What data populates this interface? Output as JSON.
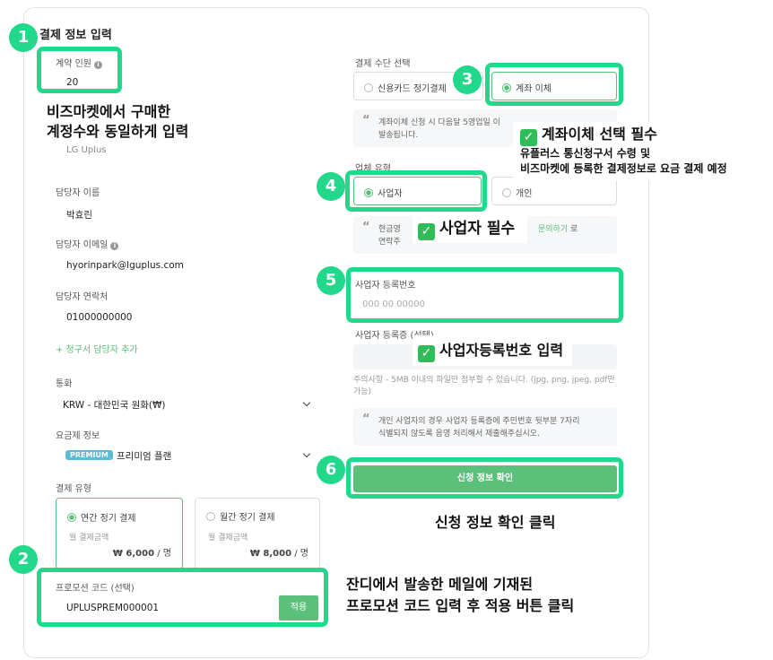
{
  "form": {
    "title": "결제 정보 입력",
    "contract_people": {
      "label": "계약 인원",
      "value": "20"
    },
    "company": {
      "value": "LG Uplus"
    },
    "manager_name": {
      "label": "담당자 이름",
      "value": "박효린"
    },
    "manager_email": {
      "label": "담당자 이메일",
      "value": "hyorinpark@lguplus.com"
    },
    "manager_phone": {
      "label": "담당자 연락처",
      "value": "01000000000"
    },
    "add_billing_contact": "+ 청구서 담당자 추가",
    "currency": {
      "label": "통화",
      "value": "KRW - 대한민국 원화(₩)"
    },
    "plan": {
      "label": "요금제 정보",
      "badge": "PREMIUM",
      "value": "프리미엄 플랜"
    },
    "billing_type": {
      "label": "결제 유형",
      "annual": {
        "label": "연간 정기 결제",
        "sub": "월 결제금액",
        "price": "₩ 6,000",
        "unit": " / 명"
      },
      "monthly": {
        "label": "월간 정기 결제",
        "sub": "월 결제금액",
        "price": "₩ 8,000",
        "unit": " / 명"
      }
    },
    "promo": {
      "label": "프로모션 코드 (선택)",
      "value": "UPLUSPREM000001",
      "apply": "적용"
    },
    "payment_method": {
      "label": "결제 수단 선택",
      "card": "신용카드 정기결제",
      "transfer": "계좌 이체"
    },
    "transfer_note": [
      "계좌이체 신청 시 다음달 5영업일 이",
      "발송됩니다."
    ],
    "business_type": {
      "label": "업체 유형",
      "business": "사업자",
      "individual": "개인"
    },
    "cash_note": {
      "line1_a": "현금영",
      "line1_link": "문의하기",
      "line1_b": " 로",
      "line2": "연락주"
    },
    "biz_number": {
      "label": "사업자 등록번호",
      "placeholder": "000 00 00000"
    },
    "biz_cert": {
      "label": "사업자 등록증 (선택)"
    },
    "upload_note": [
      "주의사항 - 5MB 이내의 파일만 첨부할 수 있습니다. (jpg, png, jpeg, pdf만",
      "가능)"
    ],
    "individual_note": [
      "개인 사업자의 경우 사업자 등록증에 주민번호 뒷부분 7자리",
      "식별되지 않도록 음영 처리해서 제출해주십시오."
    ],
    "submit": "신청 정보 확인"
  },
  "annotations": {
    "markers": [
      "1",
      "2",
      "3",
      "4",
      "5",
      "6"
    ],
    "a1": [
      "비즈마켓에서 구매한",
      "계정수와 동일하게 입력"
    ],
    "a2": [
      "잔디에서 발송한 메일에 기재된",
      "프로모션 코드 입력 후 적용 버튼 클릭"
    ],
    "a3": {
      "title": "계좌이체 선택 필수",
      "lines": [
        "유플러스 통신청구서 수령 및",
        "비즈마켓에 등록한 결제정보로 요금 결제 예정"
      ]
    },
    "a4": "사업자 필수",
    "a5": "사업자등록번호 입력",
    "a6": "신청 정보 확인 클릭",
    "check_glyph": "✓"
  },
  "colors": {
    "highlight": "#22d88a",
    "accent": "#5bc07a",
    "badge": "#5bbad5"
  }
}
